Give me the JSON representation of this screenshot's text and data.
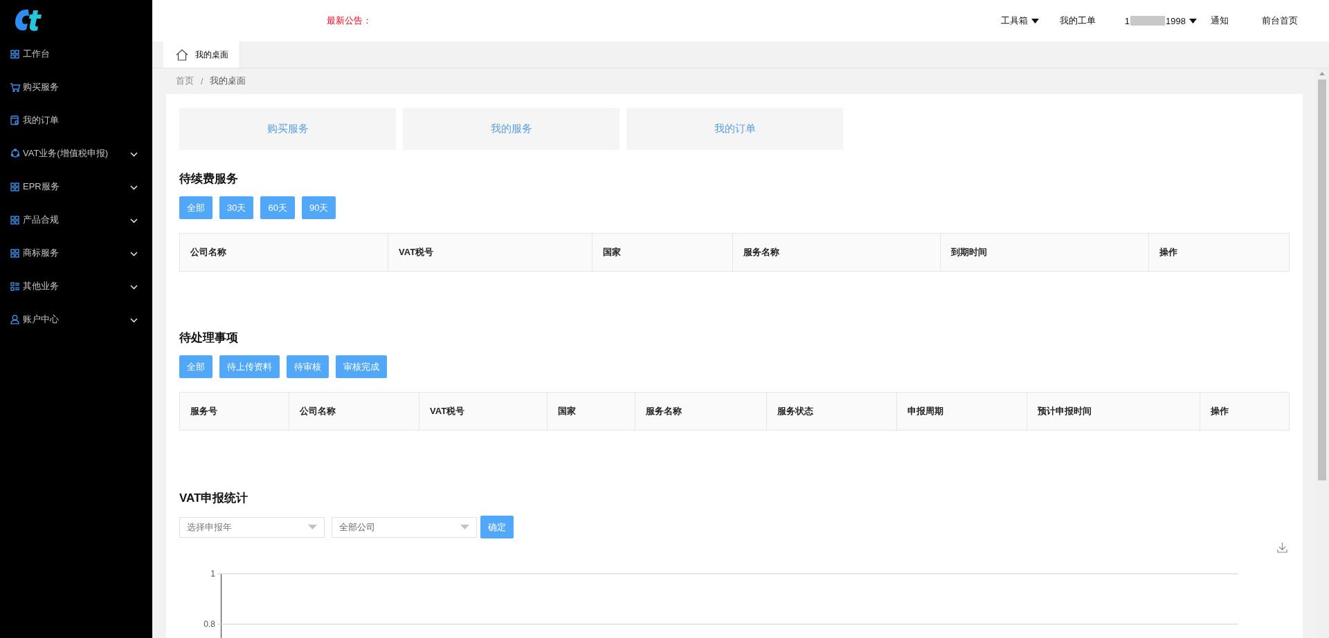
{
  "sidebar": {
    "items": [
      {
        "label": "工作台",
        "expandable": false
      },
      {
        "label": "购买服务",
        "expandable": false
      },
      {
        "label": "我的订单",
        "expandable": false
      },
      {
        "label": "VAT业务(增值税申报)",
        "expandable": true
      },
      {
        "label": "EPR服务",
        "expandable": true
      },
      {
        "label": "产品合规",
        "expandable": true
      },
      {
        "label": "商标服务",
        "expandable": true
      },
      {
        "label": "其他业务",
        "expandable": true
      },
      {
        "label": "账户中心",
        "expandable": true
      }
    ]
  },
  "header": {
    "notice_label": "最新公告：",
    "nav": [
      {
        "label": "工具箱",
        "kind": "dropdown"
      },
      {
        "label": "我的工单",
        "kind": "link"
      },
      {
        "label": "1",
        "label_end": "1998",
        "kind": "user"
      },
      {
        "label": "通知",
        "kind": "link"
      },
      {
        "label": "前台首页",
        "kind": "link"
      }
    ]
  },
  "tabs": [
    {
      "label": "我的桌面",
      "selected": true
    }
  ],
  "breadcrumb": {
    "items": [
      "首页",
      "我的桌面"
    ],
    "separator": "/"
  },
  "quick_links": [
    "购买服务",
    "我的服务",
    "我的订单"
  ],
  "renewals": {
    "title": "待续费服务",
    "filters": [
      "全部",
      "30天",
      "60天",
      "90天"
    ],
    "table": {
      "columns": [
        "公司名称",
        "VAT税号",
        "国家",
        "服务名称",
        "到期时间",
        "操作"
      ]
    }
  },
  "pending": {
    "title": "待处理事项",
    "filters": [
      "全部",
      "待上传资料",
      "待审核",
      "审核完成"
    ],
    "table": {
      "columns": [
        "服务号",
        "公司名称",
        "VAT税号",
        "国家",
        "服务名称",
        "服务状态",
        "申报周期",
        "预计申报时间",
        "操作"
      ]
    }
  },
  "vat_stats": {
    "title": "VAT申报统计",
    "year_select": {
      "placeholder": "选择申报年"
    },
    "company_select": {
      "value": "全部公司"
    },
    "confirm": "确定",
    "chart_axis_labels": [
      "1",
      "0.8"
    ]
  }
}
